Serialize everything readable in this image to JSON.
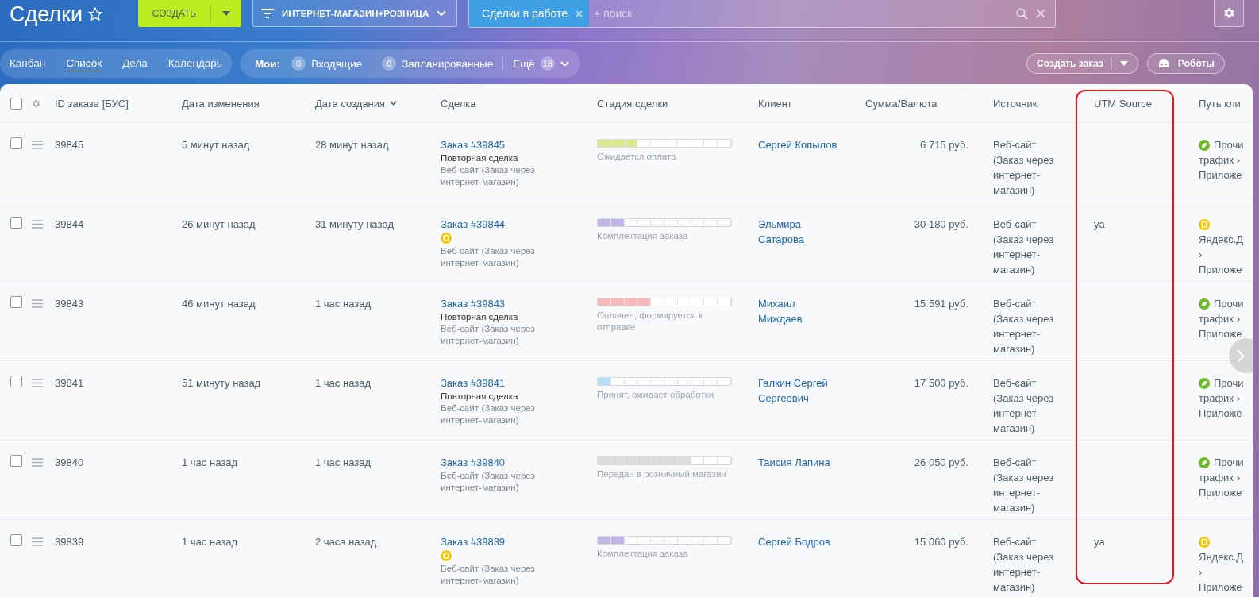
{
  "page": {
    "title": "Сделки",
    "favorite": false
  },
  "create_button": {
    "label": "СОЗДАТЬ"
  },
  "filter": {
    "label": "ИНТЕРНЕТ-МАГАЗИН+РОЗНИЦА"
  },
  "search": {
    "tag": "Сделки в работе",
    "placeholder": "+ поиск"
  },
  "views": [
    {
      "label": "Канбан",
      "selected": false
    },
    {
      "label": "Список",
      "selected": true
    },
    {
      "label": "Дела",
      "selected": false
    },
    {
      "label": "Календарь",
      "selected": false
    }
  ],
  "counters": {
    "label": "Мои:",
    "items": [
      {
        "count": "0",
        "label": "Входящие"
      },
      {
        "count": "0",
        "label": "Запланированные"
      }
    ],
    "more": {
      "label": "Ещё",
      "count": "18"
    }
  },
  "actions": [
    {
      "label": "Создать заказ",
      "kind": "split"
    },
    {
      "label": "Роботы",
      "kind": "robot"
    }
  ],
  "table": {
    "select_all": {
      "checked": false
    },
    "columns": [
      {
        "label": "ID заказа [БУС]"
      },
      {
        "label": "Дата изменения"
      },
      {
        "label": "Дата создания",
        "sorted": true
      },
      {
        "label": "Сделка"
      },
      {
        "label": "Стадия сделки"
      },
      {
        "label": "Клиент"
      },
      {
        "label": "Сумма/Валюта"
      },
      {
        "label": "Источник"
      },
      {
        "label": "UTM Source",
        "highlighted": true
      },
      {
        "label": "Путь кли"
      }
    ],
    "rows": [
      {
        "checked": false,
        "id": "39845",
        "modified": "5 минут назад",
        "created": "28 минут назад",
        "deal": {
          "title": "Заказ #39845",
          "note": "Повторная сделка",
          "source": "Веб-сайт (Заказ через интернет-магазин)"
        },
        "stage": {
          "level": 0.3,
          "color": "#d9ea8e",
          "label": "Ожидается оплата"
        },
        "client": "Сергей Копылов",
        "amount": "6 715 руб.",
        "source": "Веб-сайт (Заказ через интернет-магазин)",
        "path": {
          "kind": "organic",
          "lines": [
            "Прочи",
            "трафик ›",
            "Приложе"
          ]
        }
      },
      {
        "checked": false,
        "id": "39844",
        "modified": "26 минут назад",
        "created": "31 минуту назад",
        "deal": {
          "title": "Заказ #39844",
          "yandex": true,
          "source": "Веб-сайт (Заказ через интернет-магазин)"
        },
        "stage": {
          "level": 0.2,
          "color": "#c3b5e6",
          "label": "Комплектация заказа"
        },
        "client": "Эльмира Сатарова",
        "amount": "30 180 руб.",
        "source": "Веб-сайт (Заказ через интернет-магазин)",
        "utm": "ya",
        "path": {
          "kind": "yandex",
          "lines": [
            "Яндекс.Д",
            "›",
            "Приложе"
          ]
        }
      },
      {
        "checked": false,
        "id": "39843",
        "modified": "46 минут назад",
        "created": "1 час назад",
        "deal": {
          "title": "Заказ #39843",
          "note": "Повторная сделка",
          "source": "Веб-сайт (Заказ через интернет-магазин)"
        },
        "stage": {
          "level": 0.4,
          "color": "#f8b9b9",
          "label": "Оплачен, формируется к отправке"
        },
        "client": "Михаил Миждаев",
        "amount": "15 591 руб.",
        "source": "Веб-сайт (Заказ через интернет-магазин)",
        "path": {
          "kind": "organic",
          "lines": [
            "Прочи",
            "трафик ›",
            "Приложе"
          ]
        }
      },
      {
        "checked": false,
        "id": "39841",
        "modified": "51 минуту назад",
        "created": "1 час назад",
        "deal": {
          "title": "Заказ #39841",
          "note": "Повторная сделка",
          "source": "Веб-сайт (Заказ через интернет-магазин)"
        },
        "stage": {
          "level": 0.1,
          "color": "#b3e0f7",
          "label": "Принят, ожидает обработки"
        },
        "client": "Галкин Сергей Сергеевич",
        "amount": "17 500 руб.",
        "source": "Веб-сайт (Заказ через интернет-магазин)",
        "path": {
          "kind": "organic",
          "lines": [
            "Прочи",
            "трафик ›",
            "Приложе"
          ]
        }
      },
      {
        "checked": false,
        "id": "39840",
        "modified": "1 час назад",
        "created": "1 час назад",
        "deal": {
          "title": "Заказ #39840",
          "source": "Веб-сайт (Заказ через интернет-магазин)"
        },
        "stage": {
          "level": 0.7,
          "color": "#dcdcdc",
          "label": "Передан в розничный магазин"
        },
        "client": "Таисия Лапина",
        "amount": "26 050 руб.",
        "source": "Веб-сайт (Заказ через интернет-магазин)",
        "path": {
          "kind": "organic",
          "lines": [
            "Прочи",
            "трафик ›",
            "Приложе"
          ]
        }
      },
      {
        "checked": false,
        "id": "39839",
        "modified": "1 час назад",
        "created": "2 часа назад",
        "deal": {
          "title": "Заказ #39839",
          "yandex": true,
          "source": "Веб-сайт (Заказ через интернет-магазин)"
        },
        "stage": {
          "level": 0.2,
          "color": "#c3b5e6",
          "label": "Комплектация заказа"
        },
        "client": "Сергей Бодров",
        "amount": "15 060 руб.",
        "source": "Веб-сайт (Заказ через интернет-магазин)",
        "utm": "ya",
        "path": {
          "kind": "yandex",
          "lines": [
            "Яндекс.Д",
            "›",
            "Приложе"
          ]
        }
      }
    ]
  }
}
